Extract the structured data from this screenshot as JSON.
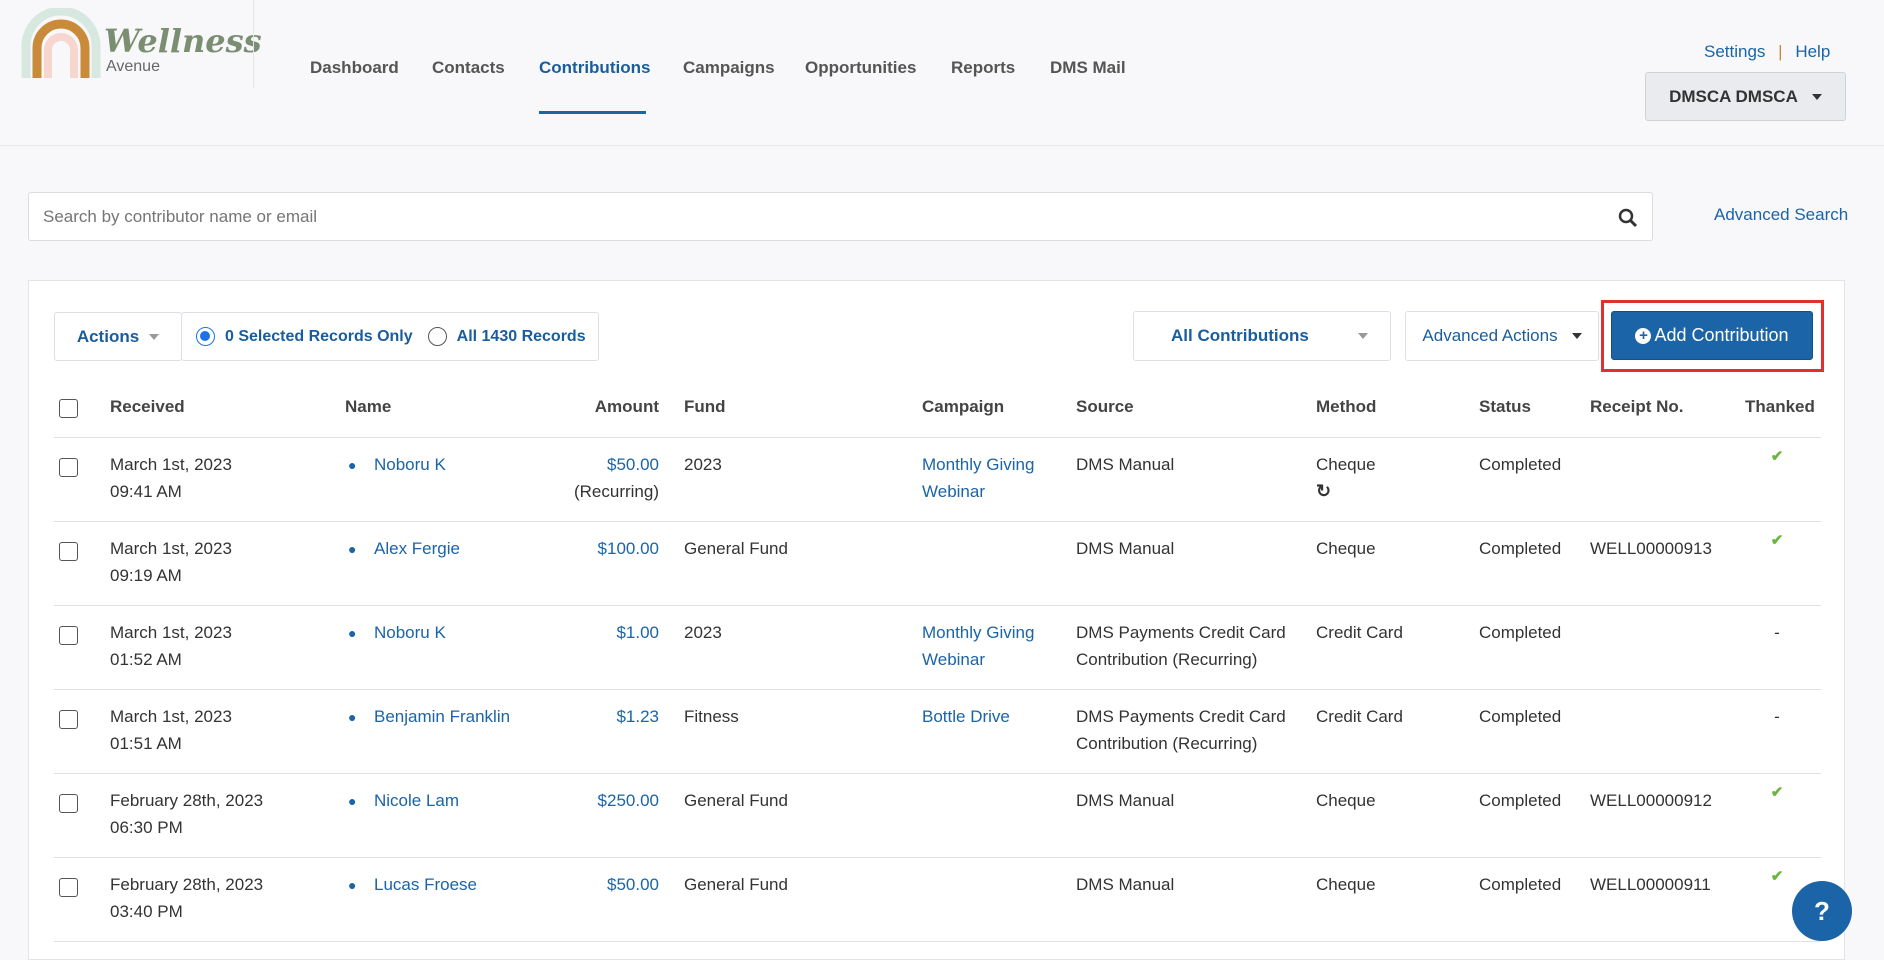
{
  "brand": {
    "name": "Wellness",
    "sub": "Avenue"
  },
  "nav": [
    "Dashboard",
    "Contacts",
    "Contributions",
    "Campaigns",
    "Opportunities",
    "Reports",
    "DMS Mail"
  ],
  "nav_active": "Contributions",
  "top_links": {
    "settings": "Settings",
    "sep": "|",
    "help": "Help"
  },
  "user_menu": "DMSCA DMSCA",
  "search": {
    "placeholder": "Search by contributor name or email",
    "advanced": "Advanced Search"
  },
  "toolbar": {
    "actions": "Actions",
    "selected": "0 Selected Records Only",
    "all": "All 1430 Records",
    "filter": "All Contributions",
    "advanced_actions": "Advanced Actions",
    "add": "Add Contribution"
  },
  "columns": [
    "Received",
    "Name",
    "Amount",
    "Fund",
    "Campaign",
    "Source",
    "Method",
    "Status",
    "Receipt No.",
    "Thanked"
  ],
  "rows": [
    {
      "date": "March 1st, 2023",
      "time": "09:41 AM",
      "name": "Noboru K",
      "amount": "$50.00",
      "amount_note": "(Recurring)",
      "fund": "2023",
      "campaign1": "Monthly Giving",
      "campaign2": "Webinar",
      "source1": "DMS Manual",
      "source2": "",
      "method": "Cheque",
      "recurring_icon": true,
      "status": "Completed",
      "receipt": "",
      "thanked": "✔"
    },
    {
      "date": "March 1st, 2023",
      "time": "09:19 AM",
      "name": "Alex Fergie",
      "amount": "$100.00",
      "amount_note": "",
      "fund": "General Fund",
      "campaign1": "",
      "campaign2": "",
      "source1": "DMS Manual",
      "source2": "",
      "method": "Cheque",
      "recurring_icon": false,
      "status": "Completed",
      "receipt": "WELL00000913",
      "thanked": "✔"
    },
    {
      "date": "March 1st, 2023",
      "time": "01:52 AM",
      "name": "Noboru K",
      "amount": "$1.00",
      "amount_note": "",
      "fund": "2023",
      "campaign1": "Monthly Giving",
      "campaign2": "Webinar",
      "source1": "DMS Payments Credit Card",
      "source2": "Contribution (Recurring)",
      "method": "Credit Card",
      "recurring_icon": false,
      "status": "Completed",
      "receipt": "",
      "thanked": "-"
    },
    {
      "date": "March 1st, 2023",
      "time": "01:51 AM",
      "name": "Benjamin Franklin",
      "amount": "$1.23",
      "amount_note": "",
      "fund": "Fitness",
      "campaign1": "Bottle Drive",
      "campaign2": "",
      "source1": "DMS Payments Credit Card",
      "source2": "Contribution (Recurring)",
      "method": "Credit Card",
      "recurring_icon": false,
      "status": "Completed",
      "receipt": "",
      "thanked": "-"
    },
    {
      "date": "February 28th, 2023",
      "time": "06:30 PM",
      "name": "Nicole Lam",
      "amount": "$250.00",
      "amount_note": "",
      "fund": "General Fund",
      "campaign1": "",
      "campaign2": "",
      "source1": "DMS Manual",
      "source2": "",
      "method": "Cheque",
      "recurring_icon": false,
      "status": "Completed",
      "receipt": "WELL00000912",
      "thanked": "✔"
    },
    {
      "date": "February 28th, 2023",
      "time": "03:40 PM",
      "name": "Lucas Froese",
      "amount": "$50.00",
      "amount_note": "",
      "fund": "General Fund",
      "campaign1": "",
      "campaign2": "",
      "source1": "DMS Manual",
      "source2": "",
      "method": "Cheque",
      "recurring_icon": false,
      "status": "Completed",
      "receipt": "WELL00000911",
      "thanked": "✔"
    }
  ],
  "help_bubble": "?",
  "colors": {
    "primary": "#1a64a7",
    "highlight": "#e03131",
    "thanked": "#6cb33f"
  }
}
